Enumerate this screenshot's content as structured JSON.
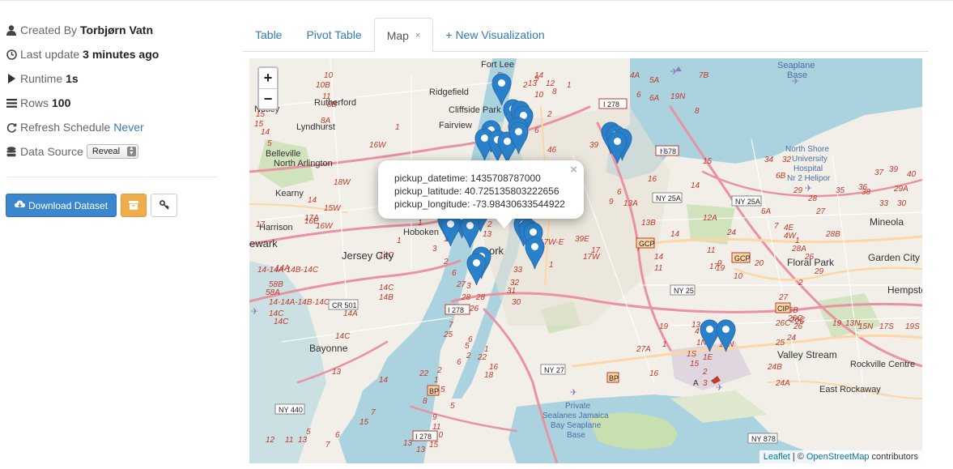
{
  "sidebar": {
    "created_by_label": "Created By",
    "created_by": "Torbjørn Vatn",
    "last_update_label": "Last update",
    "last_update": "3 minutes ago",
    "runtime_label": "Runtime",
    "runtime": "1s",
    "rows_label": "Rows",
    "rows": "100",
    "refresh_label": "Refresh Schedule",
    "refresh": "Never",
    "data_source_label": "Data Source",
    "data_source": "Reveal",
    "download_label": "Download Dataset"
  },
  "tabs": [
    {
      "label": "Table",
      "active": false
    },
    {
      "label": "Pivot Table",
      "active": false
    },
    {
      "label": "Map",
      "active": true,
      "close": "×"
    },
    {
      "label": "+ New Visualization",
      "active": false
    }
  ],
  "map": {
    "zoom_in": "+",
    "zoom_out": "−",
    "popup": {
      "datetime": "pickup_datetime: 1435708787000",
      "latitude": "pickup_latitude: 40.725135803222656",
      "longitude": "pickup_longitude: -73.98430633544922",
      "close": "×"
    },
    "attribution": {
      "leaflet": "Leaflet",
      "sep": "| ©",
      "osm": "OpenStreetMap",
      "suffix": "contributors"
    },
    "labels": [
      "Fort Lee",
      "Ridgefield",
      "Cliffside Park",
      "Fairview",
      "Rutherford",
      "Lyndhurst",
      "Nutley",
      "Belleville",
      "North Arlington",
      "Kearny",
      "Harrison",
      "ewark",
      "Jersey City",
      "Hoboken",
      "Seaplane Base",
      "North Shore University Hospital Nr 2 Helipor",
      "Mineola",
      "Garden City",
      "Floral Park",
      "Hempste",
      "Valley Stream",
      "Rockville Centre",
      "East Rockaway",
      "Bayonne",
      "Private Sealanes Jamaica Bay Seaplane Base",
      "NY 25A",
      "NY 25",
      "NY 27",
      "NY 440",
      "NY 878",
      "I 278",
      "I 678",
      "GCP",
      "CIP",
      "CR 501",
      "BP"
    ],
    "accent": "#2a81cb"
  }
}
